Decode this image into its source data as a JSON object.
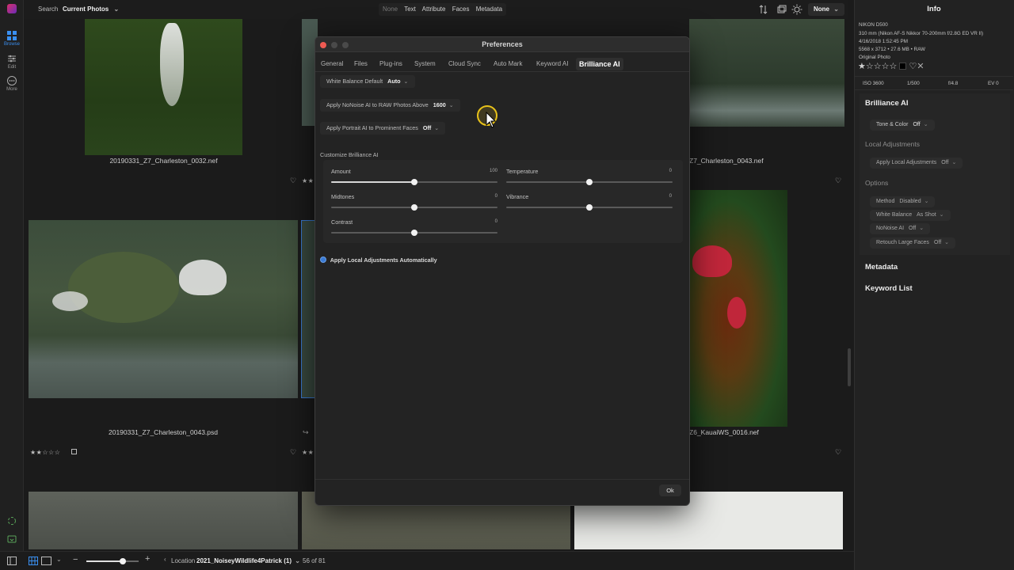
{
  "top": {
    "search_label": "Search",
    "search_value": "Current Photos",
    "filters": [
      "None",
      "Text",
      "Attribute",
      "Faces",
      "Metadata"
    ],
    "sort_value": "None"
  },
  "left_rail": {
    "items": [
      {
        "label": "Browse",
        "icon": "grid-icon"
      },
      {
        "label": "Edit",
        "icon": "sliders-icon"
      },
      {
        "label": "More",
        "icon": "ellipsis-icon"
      }
    ]
  },
  "grid": {
    "captions": [
      "20190331_Z7_Charleston_0032.nef",
      "Z7_Charleston_0043.nef",
      "20190331_Z7_Charleston_0043.psd",
      "Z6_KauaiWS_0016.nef"
    ],
    "stars_row": "★★☆☆☆"
  },
  "dialog": {
    "title": "Preferences",
    "tabs": [
      "General",
      "Files",
      "Plug-ins",
      "System",
      "Cloud Sync",
      "Auto Mark",
      "Keyword AI",
      "Brilliance AI"
    ],
    "active_tab": "Brilliance AI",
    "white_balance": {
      "label": "White Balance Default",
      "value": "Auto"
    },
    "noise": {
      "label": "Apply NoNoise AI to RAW Photos Above",
      "value": "1600"
    },
    "portrait": {
      "label": "Apply Portrait AI to Prominent Faces",
      "value": "Off"
    },
    "customize_label": "Customize Brilliance AI",
    "sliders": [
      {
        "label": "Amount",
        "value": "100",
        "fraction": 0.5
      },
      {
        "label": "Temperature",
        "value": "0",
        "fraction": 0.5
      },
      {
        "label": "Midtones",
        "value": "0",
        "fraction": 0.5
      },
      {
        "label": "Vibrance",
        "value": "0",
        "fraction": 0.5
      },
      {
        "label": "Contrast",
        "value": "0",
        "fraction": 0.5
      }
    ],
    "local_adjust_label": "Apply Local Adjustments Automatically",
    "ok_label": "Ok"
  },
  "info": {
    "title": "Info",
    "camera": "NIKON D500",
    "lens": "310 mm (Nikon AF-S Nikkor 70-200mm f/2.8G ED VR II)",
    "datetime": "4/16/2018 1:52:45 PM",
    "dims": "5568 x 3712 • 27.6 MB • RAW",
    "kind": "Original Photo",
    "iso": "ISO 3600",
    "shutter": "1/500",
    "aperture": "f/4.8",
    "ev": "EV 0",
    "brilliance_title": "Brilliance AI",
    "tone_color": {
      "label": "Tone & Color",
      "value": "Off"
    },
    "local_adjust_title": "Local Adjustments",
    "apply_local": {
      "label": "Apply Local Adjustments",
      "value": "Off"
    },
    "options_title": "Options",
    "options": [
      {
        "label": "Method",
        "value": "Disabled"
      },
      {
        "label": "White Balance",
        "value": "As Shot"
      },
      {
        "label": "NoNoise AI",
        "value": "Off"
      },
      {
        "label": "Retouch Large Faces",
        "value": "Off"
      }
    ],
    "metadata_title": "Metadata",
    "keyword_title": "Keyword List"
  },
  "bottom": {
    "location_label": "Location",
    "location_value": "2021_NoiseyWildlife4Patrick (1)",
    "count": "56 of 81",
    "zoom_fraction": 0.7
  },
  "colors": {
    "accent": "#3a7bd5",
    "cursor_ring": "#e8c21a"
  }
}
